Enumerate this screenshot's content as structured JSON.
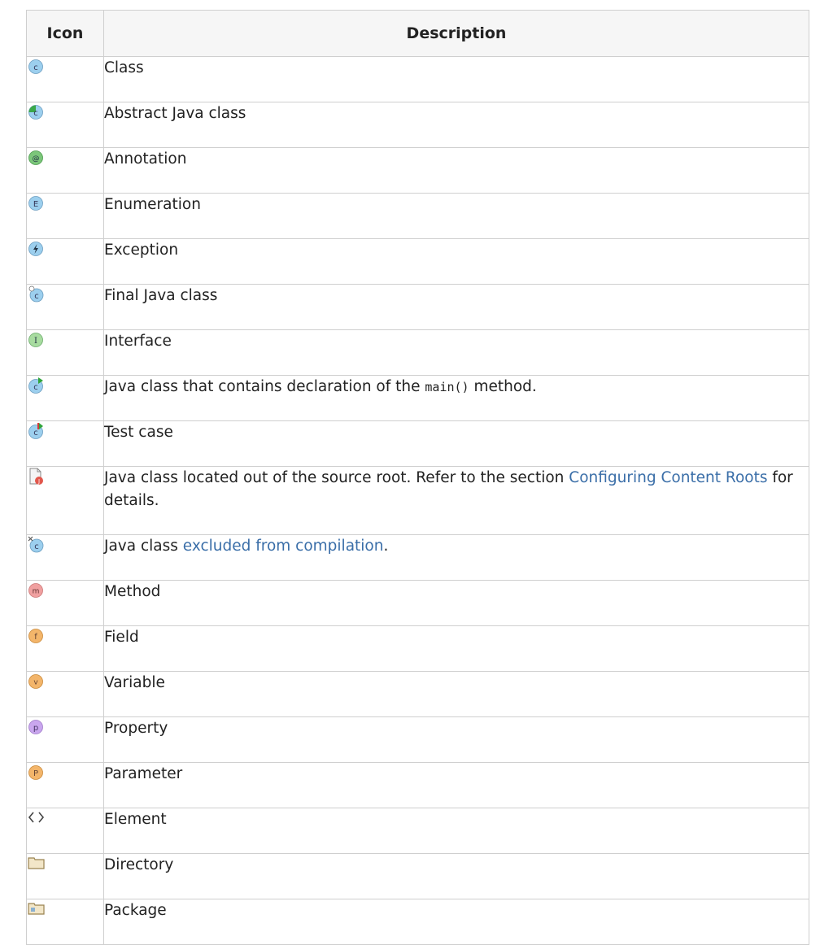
{
  "table": {
    "headers": {
      "icon": "Icon",
      "description": "Description"
    },
    "rows": [
      {
        "icon": "class-icon",
        "parts": [
          {
            "text": "Class"
          }
        ]
      },
      {
        "icon": "abstract-class-icon",
        "parts": [
          {
            "text": "Abstract Java class"
          }
        ]
      },
      {
        "icon": "annotation-icon",
        "parts": [
          {
            "text": "Annotation"
          }
        ]
      },
      {
        "icon": "enumeration-icon",
        "parts": [
          {
            "text": "Enumeration"
          }
        ]
      },
      {
        "icon": "exception-icon",
        "parts": [
          {
            "text": "Exception"
          }
        ]
      },
      {
        "icon": "final-class-icon",
        "parts": [
          {
            "text": "Final Java class"
          }
        ]
      },
      {
        "icon": "interface-icon",
        "parts": [
          {
            "text": "Interface"
          }
        ]
      },
      {
        "icon": "main-class-icon",
        "parts": [
          {
            "text": "Java class that contains declaration of the "
          },
          {
            "text": "main()",
            "code": true
          },
          {
            "text": " method."
          }
        ]
      },
      {
        "icon": "test-case-icon",
        "parts": [
          {
            "text": "Test case"
          }
        ]
      },
      {
        "icon": "class-out-of-source-icon",
        "tall": true,
        "parts": [
          {
            "text": "Java class located out of the source root. Refer to the section "
          },
          {
            "text": "Configuring Content Roots",
            "link": true
          },
          {
            "text": " for details."
          }
        ]
      },
      {
        "icon": "excluded-class-icon",
        "parts": [
          {
            "text": "Java class "
          },
          {
            "text": "excluded from compilation",
            "link": true
          },
          {
            "text": "."
          }
        ]
      },
      {
        "icon": "method-icon",
        "parts": [
          {
            "text": "Method"
          }
        ]
      },
      {
        "icon": "field-icon",
        "parts": [
          {
            "text": "Field"
          }
        ]
      },
      {
        "icon": "variable-icon",
        "parts": [
          {
            "text": "Variable"
          }
        ]
      },
      {
        "icon": "property-icon",
        "parts": [
          {
            "text": "Property"
          }
        ]
      },
      {
        "icon": "parameter-icon",
        "parts": [
          {
            "text": "Parameter"
          }
        ]
      },
      {
        "icon": "element-icon",
        "parts": [
          {
            "text": "Element"
          }
        ]
      },
      {
        "icon": "directory-icon",
        "parts": [
          {
            "text": "Directory"
          }
        ]
      },
      {
        "icon": "package-icon",
        "parts": [
          {
            "text": "Package"
          }
        ]
      }
    ]
  },
  "colors": {
    "link": "#3a6ea8",
    "class_blue": "#9ccfee",
    "annotation_green": "#7bc67a",
    "interface_green": "#a8dca0",
    "method_red": "#f0a0a0",
    "field_orange": "#f3b56a",
    "property_purple": "#c9a6ee"
  }
}
